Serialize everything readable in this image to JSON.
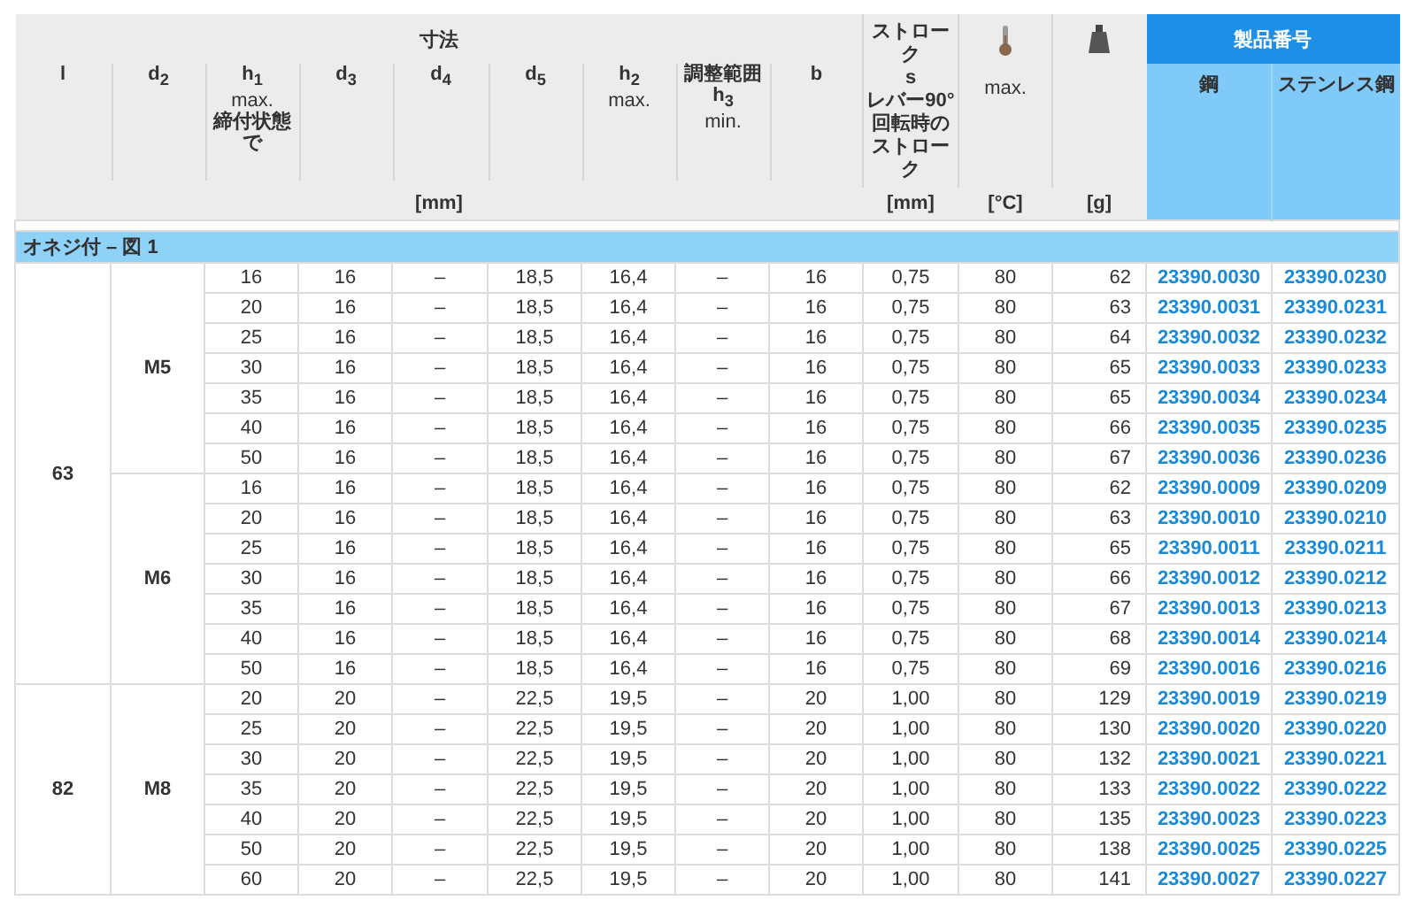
{
  "header": {
    "dimensions_label": "寸法",
    "dimensions_unit": "[mm]",
    "columns": [
      {
        "label": "l"
      },
      {
        "label": "d$_{2}$"
      },
      {
        "label": "h$_{1}$",
        "qualifier": "max.",
        "condition": "締付状態で"
      },
      {
        "label": "d$_{3}$"
      },
      {
        "label": "d$_{4}$"
      },
      {
        "label": "d$_{5}$"
      },
      {
        "label": "h$_{2}$",
        "qualifier": "max."
      },
      {
        "above": "調整範囲",
        "label": "h$_{3}$",
        "qualifier": "min."
      },
      {
        "label": "b"
      }
    ],
    "stroke": {
      "label": "ストローク",
      "symbol": "s",
      "note": "レバー90°回転時のストローク",
      "unit": "[mm]"
    },
    "temperature": {
      "label": "max.",
      "unit": "[°C]"
    },
    "weight": {
      "unit": "[g]"
    },
    "product_number": {
      "label": "製品番号",
      "columns": [
        "鋼",
        "ステンレス鋼"
      ]
    }
  },
  "section": "オネジ付 – 図 1",
  "groups": [
    {
      "l": "63",
      "subgroups": [
        {
          "d2": "M5",
          "rows": [
            [
              "16",
              "16",
              "–",
              "18,5",
              "16,4",
              "–",
              "16",
              "0,75",
              "80",
              "62",
              "23390.0030",
              "23390.0230"
            ],
            [
              "20",
              "16",
              "–",
              "18,5",
              "16,4",
              "–",
              "16",
              "0,75",
              "80",
              "63",
              "23390.0031",
              "23390.0231"
            ],
            [
              "25",
              "16",
              "–",
              "18,5",
              "16,4",
              "–",
              "16",
              "0,75",
              "80",
              "64",
              "23390.0032",
              "23390.0232"
            ],
            [
              "30",
              "16",
              "–",
              "18,5",
              "16,4",
              "–",
              "16",
              "0,75",
              "80",
              "65",
              "23390.0033",
              "23390.0233"
            ],
            [
              "35",
              "16",
              "–",
              "18,5",
              "16,4",
              "–",
              "16",
              "0,75",
              "80",
              "65",
              "23390.0034",
              "23390.0234"
            ],
            [
              "40",
              "16",
              "–",
              "18,5",
              "16,4",
              "–",
              "16",
              "0,75",
              "80",
              "66",
              "23390.0035",
              "23390.0235"
            ],
            [
              "50",
              "16",
              "–",
              "18,5",
              "16,4",
              "–",
              "16",
              "0,75",
              "80",
              "67",
              "23390.0036",
              "23390.0236"
            ]
          ]
        },
        {
          "d2": "M6",
          "rows": [
            [
              "16",
              "16",
              "–",
              "18,5",
              "16,4",
              "–",
              "16",
              "0,75",
              "80",
              "62",
              "23390.0009",
              "23390.0209"
            ],
            [
              "20",
              "16",
              "–",
              "18,5",
              "16,4",
              "–",
              "16",
              "0,75",
              "80",
              "63",
              "23390.0010",
              "23390.0210"
            ],
            [
              "25",
              "16",
              "–",
              "18,5",
              "16,4",
              "–",
              "16",
              "0,75",
              "80",
              "65",
              "23390.0011",
              "23390.0211"
            ],
            [
              "30",
              "16",
              "–",
              "18,5",
              "16,4",
              "–",
              "16",
              "0,75",
              "80",
              "66",
              "23390.0012",
              "23390.0212"
            ],
            [
              "35",
              "16",
              "–",
              "18,5",
              "16,4",
              "–",
              "16",
              "0,75",
              "80",
              "67",
              "23390.0013",
              "23390.0213"
            ],
            [
              "40",
              "16",
              "–",
              "18,5",
              "16,4",
              "–",
              "16",
              "0,75",
              "80",
              "68",
              "23390.0014",
              "23390.0214"
            ],
            [
              "50",
              "16",
              "–",
              "18,5",
              "16,4",
              "–",
              "16",
              "0,75",
              "80",
              "69",
              "23390.0016",
              "23390.0216"
            ]
          ]
        }
      ]
    },
    {
      "l": "82",
      "subgroups": [
        {
          "d2": "M8",
          "rows": [
            [
              "20",
              "20",
              "–",
              "22,5",
              "19,5",
              "–",
              "20",
              "1,00",
              "80",
              "129",
              "23390.0019",
              "23390.0219"
            ],
            [
              "25",
              "20",
              "–",
              "22,5",
              "19,5",
              "–",
              "20",
              "1,00",
              "80",
              "130",
              "23390.0020",
              "23390.0220"
            ],
            [
              "30",
              "20",
              "–",
              "22,5",
              "19,5",
              "–",
              "20",
              "1,00",
              "80",
              "132",
              "23390.0021",
              "23390.0221"
            ],
            [
              "35",
              "20",
              "–",
              "22,5",
              "19,5",
              "–",
              "20",
              "1,00",
              "80",
              "133",
              "23390.0022",
              "23390.0222"
            ],
            [
              "40",
              "20",
              "–",
              "22,5",
              "19,5",
              "–",
              "20",
              "1,00",
              "80",
              "135",
              "23390.0023",
              "23390.0223"
            ],
            [
              "50",
              "20",
              "–",
              "22,5",
              "19,5",
              "–",
              "20",
              "1,00",
              "80",
              "138",
              "23390.0025",
              "23390.0225"
            ],
            [
              "60",
              "20",
              "–",
              "22,5",
              "19,5",
              "–",
              "20",
              "1,00",
              "80",
              "141",
              "23390.0027",
              "23390.0227"
            ]
          ]
        }
      ]
    }
  ]
}
